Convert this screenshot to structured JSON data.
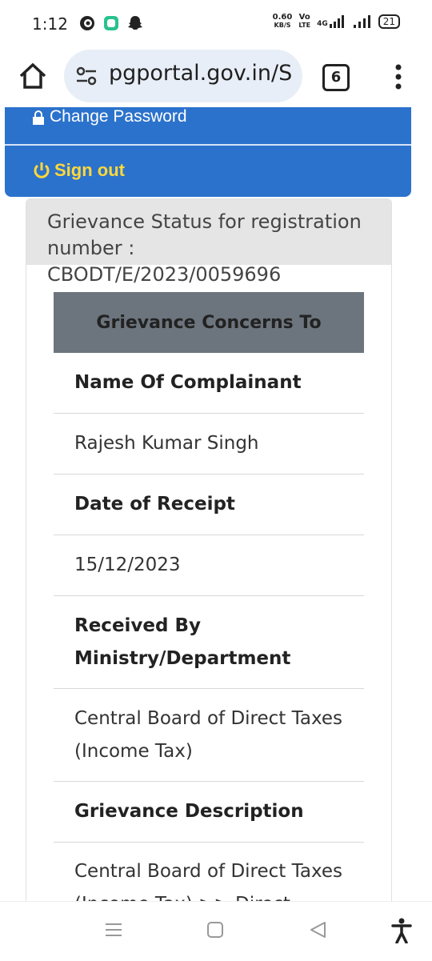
{
  "status_bar": {
    "time": "1:12",
    "speed_value": "0.60",
    "speed_unit": "KB/S",
    "volte_top": "Vo",
    "volte_bottom": "LTE",
    "network": "4G",
    "battery": "21"
  },
  "browser": {
    "url": "pgportal.gov.in/S",
    "tab_count": "6"
  },
  "nav": {
    "change_password": "Change Password",
    "sign_out": "Sign out",
    "signout_color": "#ffd83a",
    "bg_color": "#2b72cc"
  },
  "card": {
    "header": "Grievance Status for registration number : CBODT/E/2023/0059696",
    "table_header": "Grievance Concerns To",
    "rows": [
      {
        "text": "Name Of Complainant",
        "type": "label"
      },
      {
        "text": "Rajesh Kumar Singh",
        "type": "value"
      },
      {
        "text": "Date of Receipt",
        "type": "label"
      },
      {
        "text": "15/12/2023",
        "type": "value"
      },
      {
        "text": "Received By Ministry/Department",
        "type": "label"
      },
      {
        "text": "Central Board of Direct Taxes (Income Tax)",
        "type": "value"
      },
      {
        "text": "Grievance Description",
        "type": "label"
      },
      {
        "text": "Central Board of Direct Taxes (Income Tax) >> Direct Taxes",
        "type": "value"
      }
    ]
  },
  "icons": {
    "home": "home-icon",
    "tune": "tune-icon",
    "tabs": "tabs-icon",
    "menu": "more-vert-icon",
    "lock": "lock-icon",
    "power": "power-icon",
    "recents": "menu-lines-icon",
    "home_nav": "square-icon",
    "back": "back-triangle-icon",
    "accessibility": "accessibility-icon"
  }
}
